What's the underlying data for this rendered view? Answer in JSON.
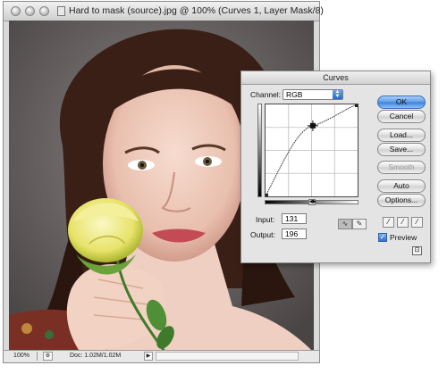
{
  "document": {
    "title": "Hard to mask (source).jpg @ 100% (Curves 1, Layer Mask/8)",
    "zoom": "100%",
    "doc_size": "Doc: 1.02M/1.02M"
  },
  "curves": {
    "title": "Curves",
    "channel_label": "Channel:",
    "channel_value": "RGB",
    "input_label": "Input:",
    "input_value": "131",
    "output_label": "Output:",
    "output_value": "196",
    "buttons": {
      "ok": "OK",
      "cancel": "Cancel",
      "load": "Load...",
      "save": "Save...",
      "smooth": "Smooth",
      "auto": "Auto",
      "options": "Options..."
    },
    "preview_label": "Preview",
    "preview_checked": true,
    "curve_point": {
      "input": 131,
      "output": 196
    }
  },
  "colors": {
    "accent": "#3a7fdc",
    "background": "#5b5656"
  },
  "icons": {
    "curve_tool": "curve-tool-icon",
    "pencil_tool": "pencil-tool-icon",
    "eyedropper_black": "black-eyedropper-icon",
    "eyedropper_gray": "gray-eyedropper-icon",
    "eyedropper_white": "white-eyedropper-icon"
  }
}
